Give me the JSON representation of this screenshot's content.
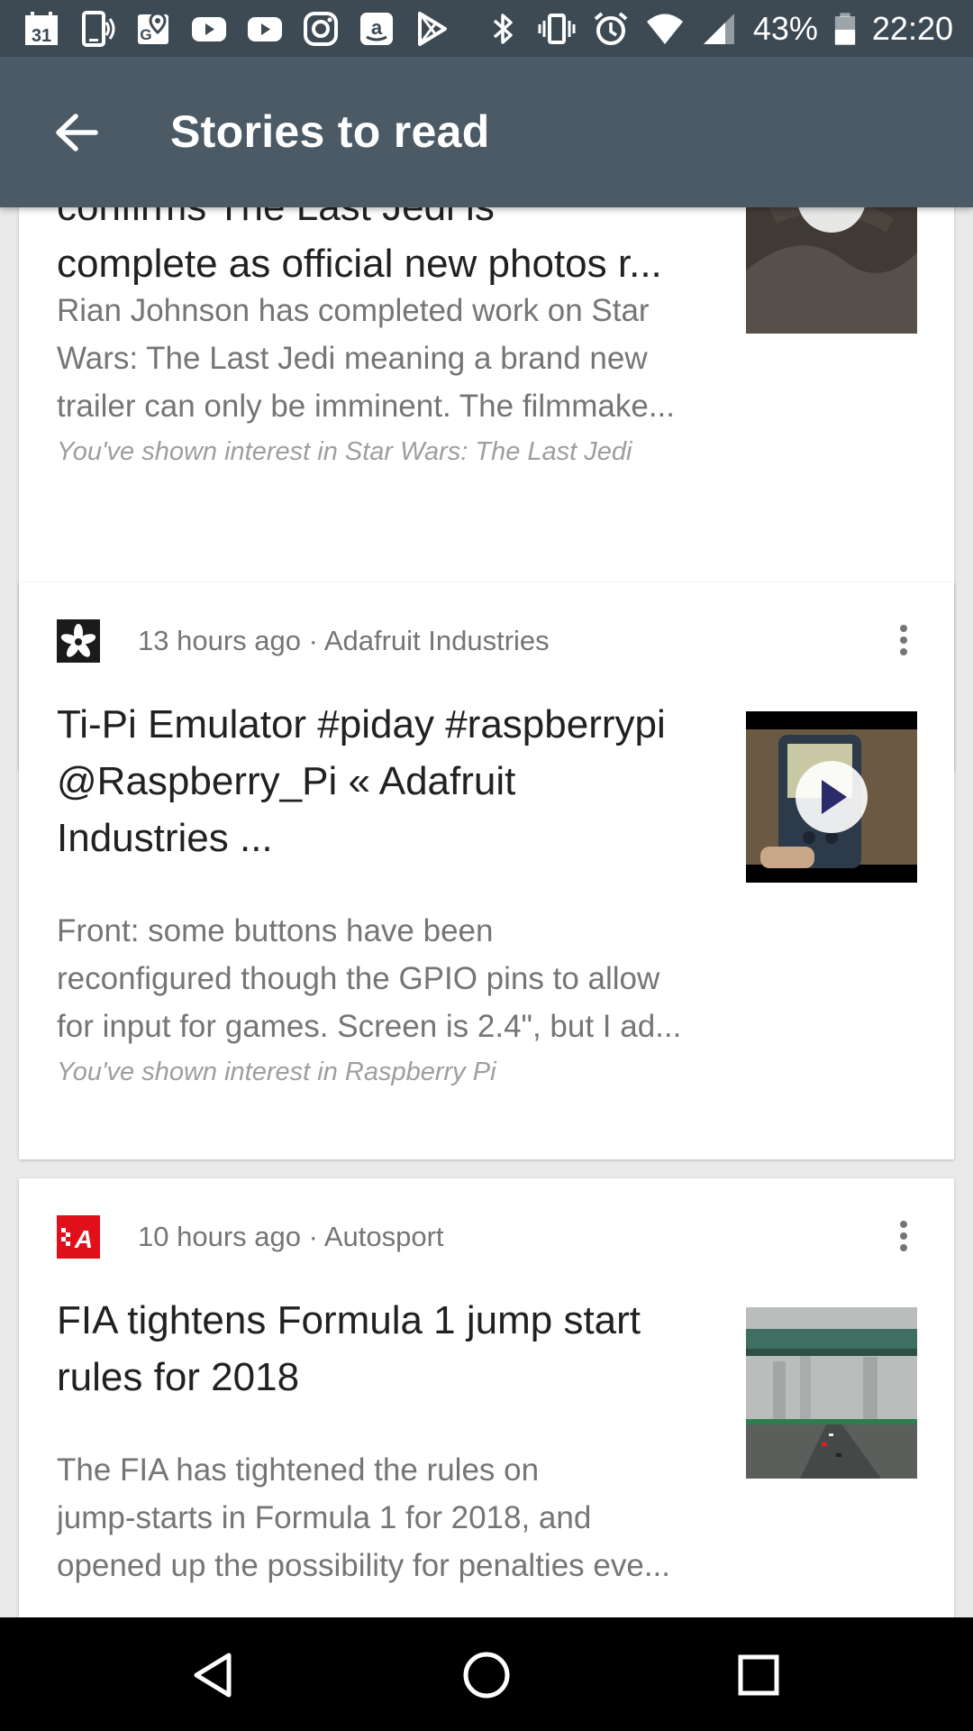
{
  "status_bar": {
    "battery": "43%",
    "time": "22:20",
    "left_icons": [
      "calendar-icon",
      "phone-signal-icon",
      "maps-icon",
      "youtube-icon",
      "youtube-icon",
      "instagram-icon",
      "amazon-icon",
      "play-store-icon"
    ],
    "right_icons": [
      "bluetooth-icon",
      "vibrate-icon",
      "alarm-icon",
      "wifi-icon",
      "cell-signal-icon",
      "battery-icon"
    ],
    "calendar_day": "31"
  },
  "app_bar": {
    "title": "Stories to read",
    "back_icon": "arrow-back-icon"
  },
  "cards": [
    {
      "headline_lines": [
        "confirms The Last Jedi is",
        "complete as official new photos r..."
      ],
      "summary_lines": [
        "Rian Johnson has completed work on Star",
        "Wars: The Last Jedi meaning a brand new",
        "trailer can only be imminent. The filmmake..."
      ],
      "interest": "You've shown interest in Star Wars: The Last Jedi"
    },
    {
      "meta": "13 hours ago · Adafruit Industries",
      "headline_lines": [
        "Ti-Pi Emulator #piday #raspberrypi",
        "@Raspberry_Pi « Adafruit",
        "Industries ..."
      ],
      "summary_lines": [
        "Front: some buttons have been",
        "reconfigured though the GPIO pins to allow",
        "for input for games. Screen is 2.4\", but I ad..."
      ],
      "interest": "You've shown interest in Raspberry Pi"
    },
    {
      "meta": "10 hours ago · Autosport",
      "logo_text": "A",
      "headline_lines": [
        "FIA tightens Formula 1 jump start",
        "rules for 2018"
      ],
      "summary_lines": [
        "The FIA has tightened the rules on",
        "jump-starts in Formula 1 for 2018, and",
        "opened up the possibility for penalties eve..."
      ]
    }
  ],
  "colors": {
    "status_bar": "#3d4a54",
    "app_bar": "#4b5a65",
    "background": "#e9e9e9",
    "card": "#ffffff",
    "autosport_red": "#e0101a"
  },
  "nav_bar": {
    "icons": [
      "back-triangle-icon",
      "home-circle-icon",
      "recents-square-icon"
    ]
  }
}
